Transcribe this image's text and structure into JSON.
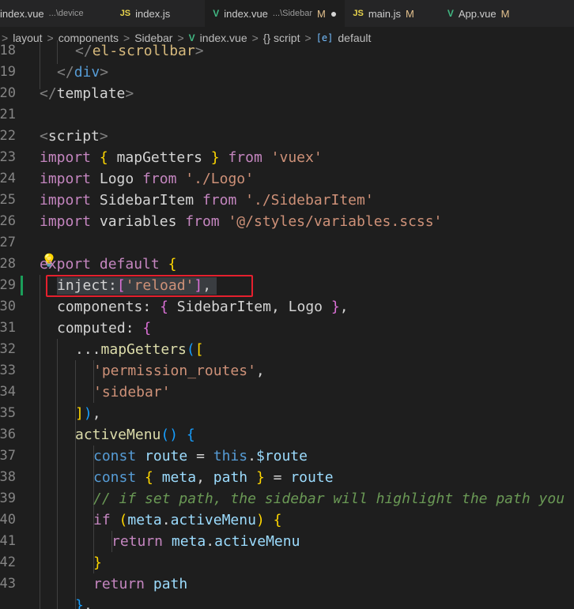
{
  "tabs": [
    {
      "name": "index.vue",
      "desc": "...\\device",
      "icon": "vue-icon",
      "active": false,
      "badge": ""
    },
    {
      "name": "index.js",
      "desc": "",
      "icon": "js-icon",
      "icon_text": "JS",
      "active": false,
      "badge": ""
    },
    {
      "name": "index.vue",
      "desc": "...\\Sidebar",
      "icon": "vue-icon",
      "icon_text": "V",
      "active": true,
      "badge": "M",
      "modified_dot": "●"
    },
    {
      "name": "main.js",
      "desc": "",
      "icon": "js-icon",
      "icon_text": "JS",
      "active": false,
      "badge": "M"
    },
    {
      "name": "App.vue",
      "desc": "",
      "icon": "vue-icon",
      "icon_text": "V",
      "active": false,
      "badge": "M"
    }
  ],
  "breadcrumb": {
    "items": [
      "layout",
      "components",
      "Sidebar",
      "index.vue",
      "{} script",
      "default"
    ],
    "separator": ">",
    "vue_icon_text": "V",
    "default_icon_text": "[e]"
  },
  "editor": {
    "line_numbers": [
      "18",
      "19",
      "20",
      "21",
      "22",
      "23",
      "24",
      "25",
      "26",
      "27",
      "28",
      "29",
      "30",
      "31",
      "32",
      "33",
      "34",
      "35",
      "36",
      "37",
      "38",
      "39",
      "40",
      "41",
      "42",
      "43"
    ],
    "highlighted_line": "29",
    "colors": {
      "highlight_border": "#e5202e",
      "modified_bar": "#1b9e5a"
    }
  }
}
